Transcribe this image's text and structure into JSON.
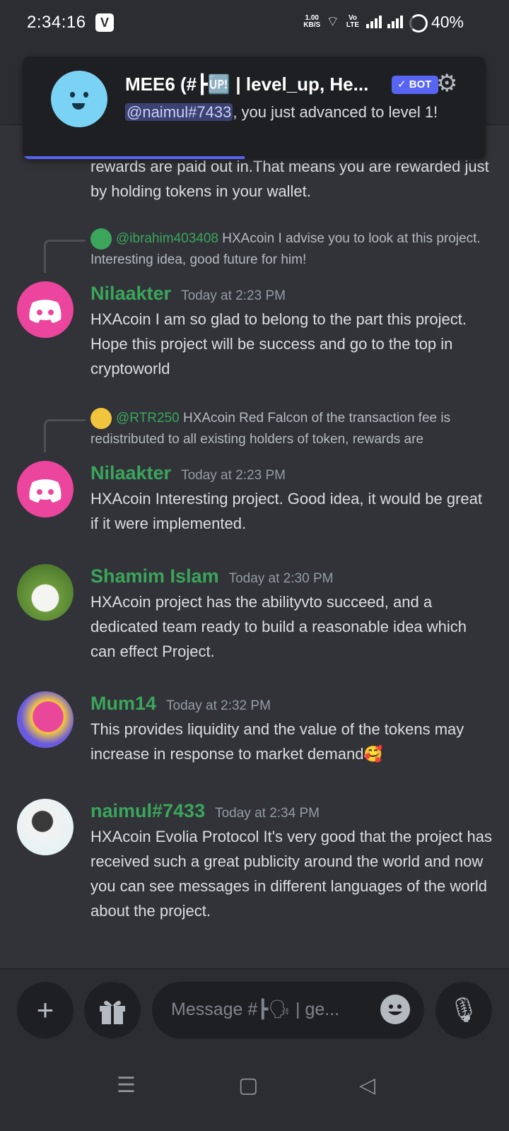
{
  "status_bar": {
    "time": "2:34:16",
    "notification_badge": "V",
    "net_speed_value": "1.00",
    "net_speed_unit": "KB/S",
    "volte_label": "Vo LTE",
    "battery": "40%"
  },
  "toast": {
    "title": "MEE6 (#┣🆙 | level_up, He...",
    "bot_badge": "✓ BOT",
    "mention": "@naimul#7433",
    "message": ", you just advanced to level 1!",
    "progress_fraction": 0.48
  },
  "messages": {
    "prev_tail": "rewards are paid out in.That means you are rewarded just by holding tokens in your wallet.",
    "m1": {
      "reply_user": "@ibrahim403408",
      "reply_text": "HXAcoin I advise you to look at this project. Interesting idea, good future for him!",
      "author": "Nilaakter",
      "time": "Today at 2:23 PM",
      "text": "HXAcoin I am so glad to belong to the part this project. Hope this project will be success and go to the top in cryptoworld"
    },
    "m2": {
      "reply_user": "@RTR250",
      "reply_text": "HXAcoin Red Falcon of the transaction fee is redistributed to all existing holders of token, rewards are",
      "author": "Nilaakter",
      "time": "Today at 2:23 PM",
      "text": "HXAcoin Interesting project. Good idea, it would be great if it were implemented."
    },
    "m3": {
      "author": "Shamim Islam",
      "time": "Today at 2:30 PM",
      "text": "HXAcoin project has the abilityvto succeed, and a dedicated team ready to build a reasonable idea which can effect Project."
    },
    "m4": {
      "author": "Mum14",
      "time": "Today at 2:32 PM",
      "text": "This provides liquidity and the value of the tokens may increase in response to market demand🥰"
    },
    "m5": {
      "author": "naimul#7433",
      "time": "Today at 2:34 PM",
      "text": "HXAcoin Evolia Protocol It's very good that the project has received such a great publicity around the world and now you can see messages in different languages of the world about the project."
    }
  },
  "composer": {
    "placeholder": "Message #┣🗣 | ge...",
    "plus_icon": "+",
    "mic_icon": "🎙"
  },
  "nav_bar": {
    "menu_icon": "☰",
    "home_icon": "▢",
    "back_icon": "◁"
  }
}
